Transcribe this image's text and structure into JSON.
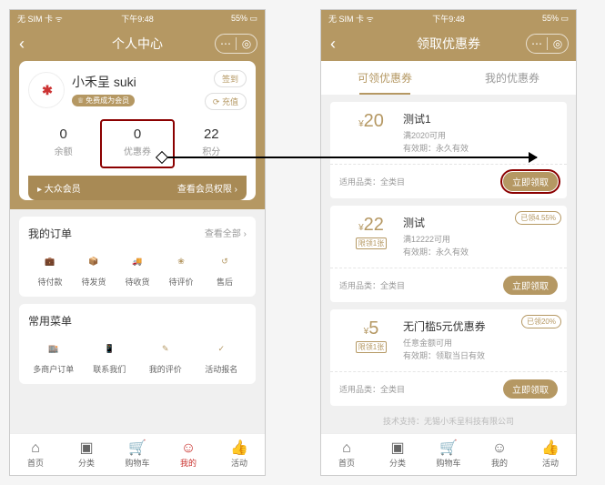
{
  "status": {
    "carrier": "无 SIM 卡",
    "wifi": "ᯤ",
    "time": "下午9:48",
    "battery": "55%",
    "batt_icon": "▭"
  },
  "p1": {
    "title": "个人中心",
    "avatar_text": "✱",
    "nickname": "小禾呈 suki",
    "badge_text": "免费成为会员",
    "btn_signin": "签到",
    "btn_recharge": "充值",
    "recharge_icon": "⟳",
    "stats": [
      {
        "num": "0",
        "lbl": "余额"
      },
      {
        "num": "0",
        "lbl": "优惠券"
      },
      {
        "num": "22",
        "lbl": "积分"
      }
    ],
    "member_left": "▸ 大众会员",
    "member_right": "查看会员权限 ›",
    "orders_title": "我的订单",
    "orders_more": "查看全部 ›",
    "orders": [
      {
        "lbl": "待付款"
      },
      {
        "lbl": "待发货"
      },
      {
        "lbl": "待收货"
      },
      {
        "lbl": "待评价"
      },
      {
        "lbl": "售后"
      }
    ],
    "menu_title": "常用菜单",
    "menus": [
      {
        "lbl": "多商户订单"
      },
      {
        "lbl": "联系我们"
      },
      {
        "lbl": "我的评价"
      },
      {
        "lbl": "活动报名"
      }
    ]
  },
  "p2": {
    "title": "领取优惠券",
    "tabs": [
      "可领优惠券",
      "我的优惠券"
    ],
    "coupons": [
      {
        "value": "20",
        "limit": "",
        "name": "测试1",
        "cond": "满2020可用",
        "exp": "有效期：永久有效",
        "corner": "",
        "scope": "适用品类：全类目",
        "btn": "立即领取",
        "hl": true
      },
      {
        "value": "22",
        "limit": "限领1张",
        "name": "测试",
        "cond": "满12222可用",
        "exp": "有效期：永久有效",
        "corner": "已领4.55%",
        "scope": "适用品类：全类目",
        "btn": "立即领取",
        "hl": false
      },
      {
        "value": "5",
        "limit": "限领1张",
        "name": "无门槛5元优惠券",
        "cond": "任意金额可用",
        "exp": "有效期：领取当日有效",
        "corner": "已领20%",
        "scope": "适用品类：全类目",
        "btn": "立即领取",
        "hl": false
      }
    ],
    "tech": "技术支持：无锡小禾呈科技有限公司"
  },
  "nav": [
    {
      "lbl": "首页",
      "ic": "⌂"
    },
    {
      "lbl": "分类",
      "ic": "▣"
    },
    {
      "lbl": "购物车",
      "ic": "🛒"
    },
    {
      "lbl": "我的",
      "ic": "☺"
    },
    {
      "lbl": "活动",
      "ic": "✿"
    }
  ],
  "nav2_icons": {
    "mine": "☺",
    "activity": "👍"
  }
}
